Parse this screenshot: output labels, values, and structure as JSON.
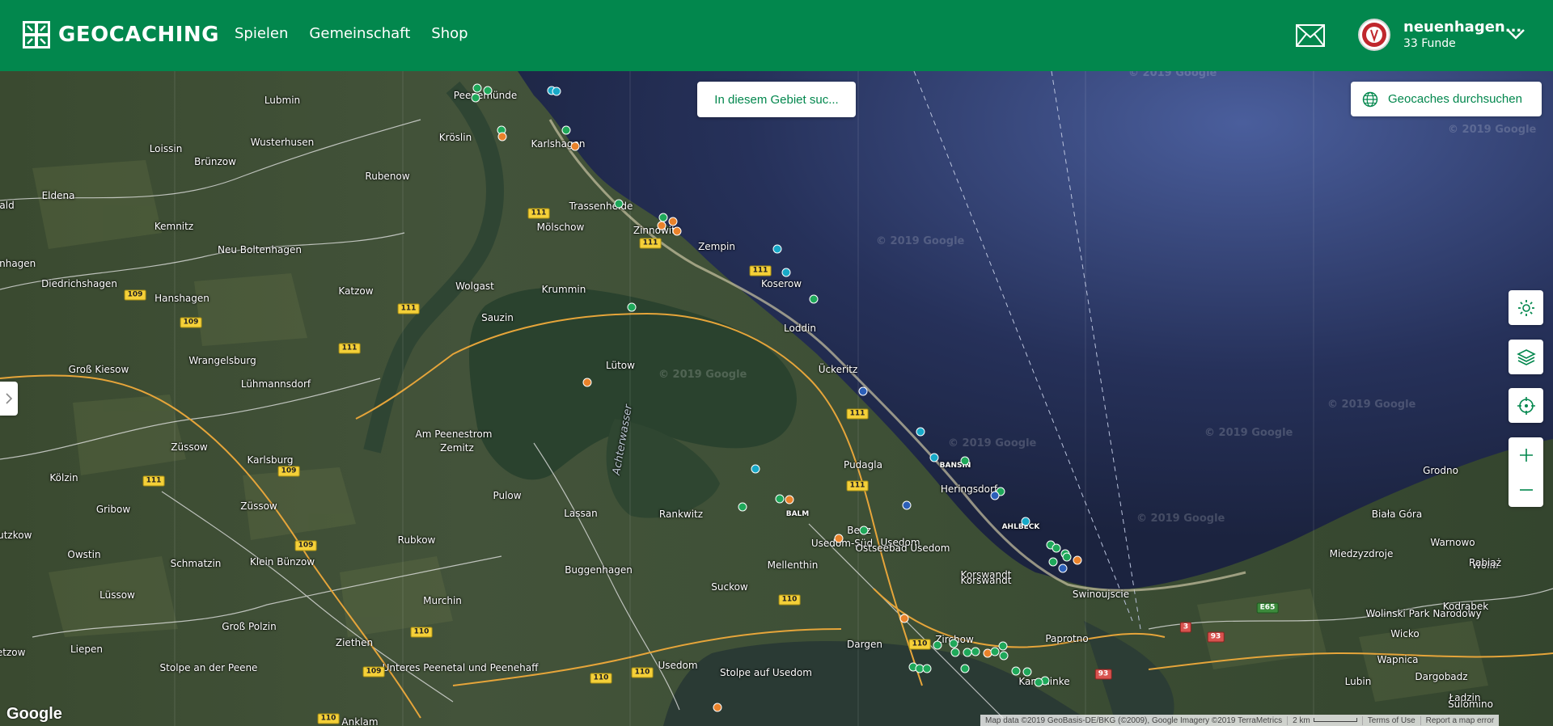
{
  "header": {
    "logo_text": "GEOCACHING",
    "nav": [
      "Spielen",
      "Gemeinschaft",
      "Shop"
    ],
    "user_name": "neuenhagen...",
    "user_finds": "33 Funde"
  },
  "map": {
    "search_area_label": "In diesem Gebiet suc...",
    "browse_label": "Geocaches durchsuchen",
    "google_logo": "Google",
    "attribution": {
      "data": "Map data ©2019 GeoBasis-DE/BKG (©2009), Google Imagery ©2019 TerraMetrics",
      "scale": "2 km",
      "terms": "Terms of Use",
      "report": "Report a map error"
    },
    "watermark": "© 2019 Google",
    "places": [
      "Lubmin",
      "Peenemünde",
      "Kröslin",
      "Karlshagen",
      "Loissin",
      "Brünzow",
      "Wusterhusen",
      "Rubenow",
      "Eldena",
      "Trassenheide",
      "Mölschow",
      "Zinnowitz",
      "Zempin",
      "Kemnitz",
      "Neu Boltenhagen",
      "Diedrichshagen",
      "Wolgast",
      "Krummin",
      "Koserow",
      "Hanshagen",
      "Katzow",
      "Sauzin",
      "Loddin",
      "Wrangelsburg",
      "Lütow",
      "Ückeritz",
      "Groß Kiesow",
      "Lühmannsdorf",
      "Am Peenestrom",
      "Zemitz",
      "Züssow",
      "Karlsburg",
      "Pudagla",
      "BANSIN",
      "Heringsdorf",
      "Kölzin",
      "Pulow",
      "Lassan",
      "Rankwitz",
      "BALM",
      "Benz",
      "Usedom-Süd",
      "Usedom",
      "AHLBECK",
      "Gribow",
      "Züssow",
      "Rubkow",
      "Mellenthin",
      "Korswandt",
      "Owstin",
      "Schmatzin",
      "Klein Bünzow",
      "Buggenhagen",
      "Suckow",
      "Swinoujscie",
      "Lüssow",
      "Murchin",
      "Groß Polzin",
      "Ziethen",
      "Dargen",
      "Zirchow",
      "Paprotno",
      "Liepen",
      "Stolpe an der Peene",
      "Unteres Peenetal und Peenehaff",
      "Usedom",
      "Stolpe auf Usedom",
      "Korswandt",
      "Kamminke",
      "Anklam",
      "Grodno",
      "Biała Góra",
      "Warnowo",
      "Miedzyzdroje",
      "Wolin",
      "Rabiąż",
      "Wolinski Park Narodowy",
      "Kodrąbek",
      "Wicko",
      "Wapnica",
      "Lubin",
      "Dargobadz",
      "Ładzin",
      "Sulomino",
      "Achterwasser",
      "Lutzkow",
      "eetzow",
      "enhagen",
      "vald",
      "Ostseebad Usedom"
    ],
    "roads": [
      "111",
      "109",
      "110",
      "3",
      "93",
      "E65"
    ],
    "cache_colors": {
      "traditional": "#1fa85a",
      "mystery": "#2c5fb8",
      "multi": "#e9822b",
      "event": "#18a9c8"
    }
  }
}
